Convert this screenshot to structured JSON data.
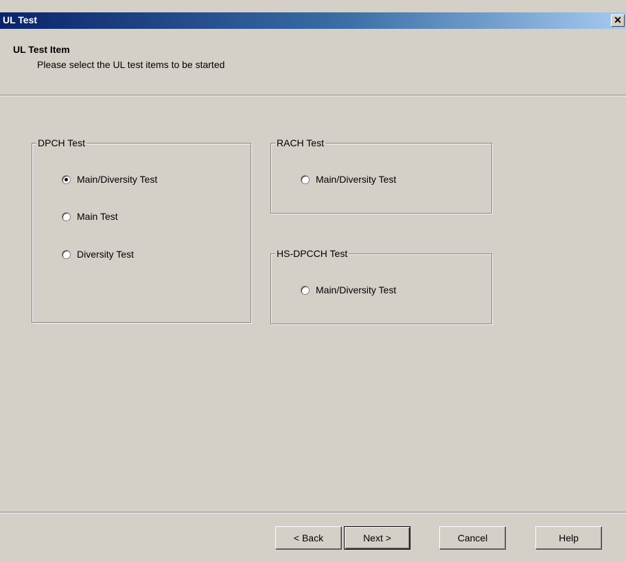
{
  "window": {
    "title": "UL Test",
    "close_glyph": "✕"
  },
  "header": {
    "title": "UL Test Item",
    "subtitle": "Please select the UL test items to be started"
  },
  "groups": {
    "dpch": {
      "label": "DPCH Test",
      "options": [
        {
          "label": "Main/Diversity Test",
          "checked": true
        },
        {
          "label": "Main Test",
          "checked": false
        },
        {
          "label": "Diversity Test",
          "checked": false
        }
      ]
    },
    "rach": {
      "label": "RACH Test",
      "options": [
        {
          "label": "Main/Diversity Test",
          "checked": false
        }
      ]
    },
    "hsdpcch": {
      "label": "HS-DPCCH Test",
      "options": [
        {
          "label": "Main/Diversity Test",
          "checked": false
        }
      ]
    }
  },
  "buttons": {
    "back": "< Back",
    "next": "Next >",
    "cancel": "Cancel",
    "help": "Help"
  },
  "colors": {
    "title_gradient_start": "#0a246a",
    "title_gradient_end": "#a6caf0",
    "dialog_face": "#d4d0c8"
  }
}
